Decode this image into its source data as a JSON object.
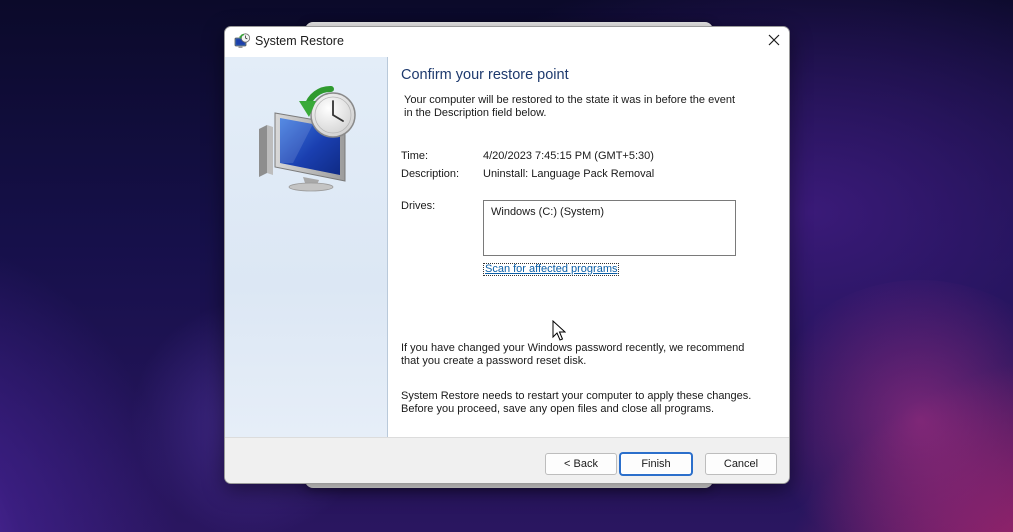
{
  "dialog": {
    "title": "System Restore",
    "close_symbol": "✕"
  },
  "content": {
    "heading": "Confirm your restore point",
    "intro_line1": "Your computer will be restored to the state it was in before the event",
    "intro_line2": "in the Description field below.",
    "time_label": "Time:",
    "time_value": "4/20/2023 7:45:15 PM (GMT+5:30)",
    "description_label": "Description:",
    "description_value": "Uninstall: Language Pack Removal",
    "drives_label": "Drives:",
    "drives": [
      "Windows (C:) (System)"
    ],
    "scan_link": "Scan for affected programs",
    "password_note_line1": "If you have changed your Windows password recently, we recommend",
    "password_note_line2": "that you create a password reset disk.",
    "restart_note_line1": "System Restore needs to restart your computer to apply these changes.",
    "restart_note_line2": "Before you proceed, save any open files and close all programs."
  },
  "footer": {
    "back_label": "< Back",
    "finish_label": "Finish",
    "cancel_label": "Cancel"
  },
  "icons": {
    "title_icon": "system-restore-icon",
    "wizard_art": "system-restore-monitor-clock-icon",
    "close_icon": "close-icon",
    "cursor": "mouse-pointer-icon"
  },
  "colors": {
    "heading": "#1e3a6e",
    "link": "#0b5fa7",
    "finish_border": "#2b6fcb",
    "side_panel": "#dce7f4"
  }
}
